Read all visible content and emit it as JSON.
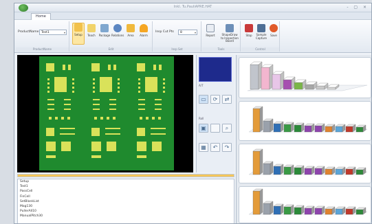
{
  "window": {
    "title": "Inkl. Tu.PauliAPRE.HAT",
    "controls": "- ▢ ×"
  },
  "tabs": {
    "home": "Home"
  },
  "ribbon": {
    "product_label": "ProductName",
    "product_value": "Test1",
    "group_labels": [
      "ProductName",
      "Edit",
      "Insp Set",
      "Tools",
      "Control"
    ],
    "buttons": [
      {
        "label": "Setup",
        "icon": "setup-icon",
        "color": "#f2c14a"
      },
      {
        "label": "Teach",
        "icon": "teach-icon",
        "color": "#f1d36a"
      },
      {
        "label": "Package",
        "icon": "package-icon",
        "color": "#7fa7cf"
      },
      {
        "label": "Relations",
        "icon": "relations-icon",
        "color": "#5b86c2"
      },
      {
        "label": "Area",
        "icon": "area-icon",
        "color": "#f0b93c"
      },
      {
        "label": "Alarm",
        "icon": "alarm-icon",
        "color": "#f5a623"
      }
    ],
    "insp_label": "Insp Cut Pts",
    "insp_value": "8",
    "tool_buttons": [
      {
        "label": "Report",
        "icon": "report-icon"
      },
      {
        "label": "ShapeDraw to Inspection Board",
        "icon": "shapedraw-icon"
      }
    ],
    "control_buttons": [
      {
        "label": "Stop",
        "icon": "stop-icon"
      },
      {
        "label": "Sample Capture",
        "icon": "capture-icon"
      },
      {
        "label": "Save",
        "icon": "save-icon"
      }
    ]
  },
  "side": {
    "label_1": "A/T",
    "label_2": "Roll"
  },
  "progress": {
    "value": 1.0
  },
  "log": {
    "items": [
      "Setup",
      "Test1",
      "PassCell",
      "FinCell",
      "SetBlankList",
      "Mag130",
      "PullerAll10",
      "ManualPitch30"
    ]
  },
  "charts": {
    "colors": [
      "#c1c5cc",
      "#f3b6cf",
      "#e8c6e8",
      "#a64fb0",
      "#7ab648",
      "#a8a8a8",
      "#c9c9c9",
      "#d9d9d9"
    ],
    "small_colors": [
      "#e39b3a",
      "#9aa1ab",
      "#2f6fb5",
      "#3a9a45",
      "#2c8a3a",
      "#8e44ad",
      "#8e44ad",
      "#e0832f",
      "#5aa5d8",
      "#c0392b",
      "#2e8a3a"
    ]
  }
}
